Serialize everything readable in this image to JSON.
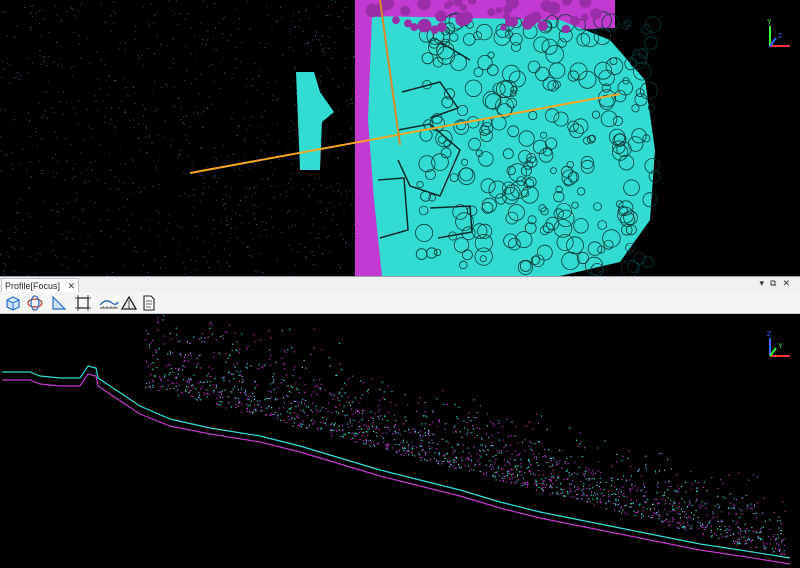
{
  "profile_panel": {
    "tab_title": "Profile[Focus]",
    "close_glyph": "✕",
    "window_controls": [
      "▾",
      "⧉",
      "✕"
    ]
  },
  "toolbar": {
    "tools": [
      {
        "icon": "box-view-icon"
      },
      {
        "icon": "orbit-icon"
      },
      {
        "icon": "slope-icon"
      },
      {
        "icon": "crosshair-grid-icon"
      },
      {
        "icon": "ruler-measure-icon"
      },
      {
        "icon": "triangle-points-icon"
      },
      {
        "icon": "report-document-icon"
      }
    ]
  },
  "axis_gizmo": {
    "x": "X",
    "y": "Y",
    "z": "Z"
  },
  "colors": {
    "cyan": "#35e0d6",
    "magenta": "#c23ad0",
    "profile_line": "#f5a623",
    "background": "#000000"
  }
}
